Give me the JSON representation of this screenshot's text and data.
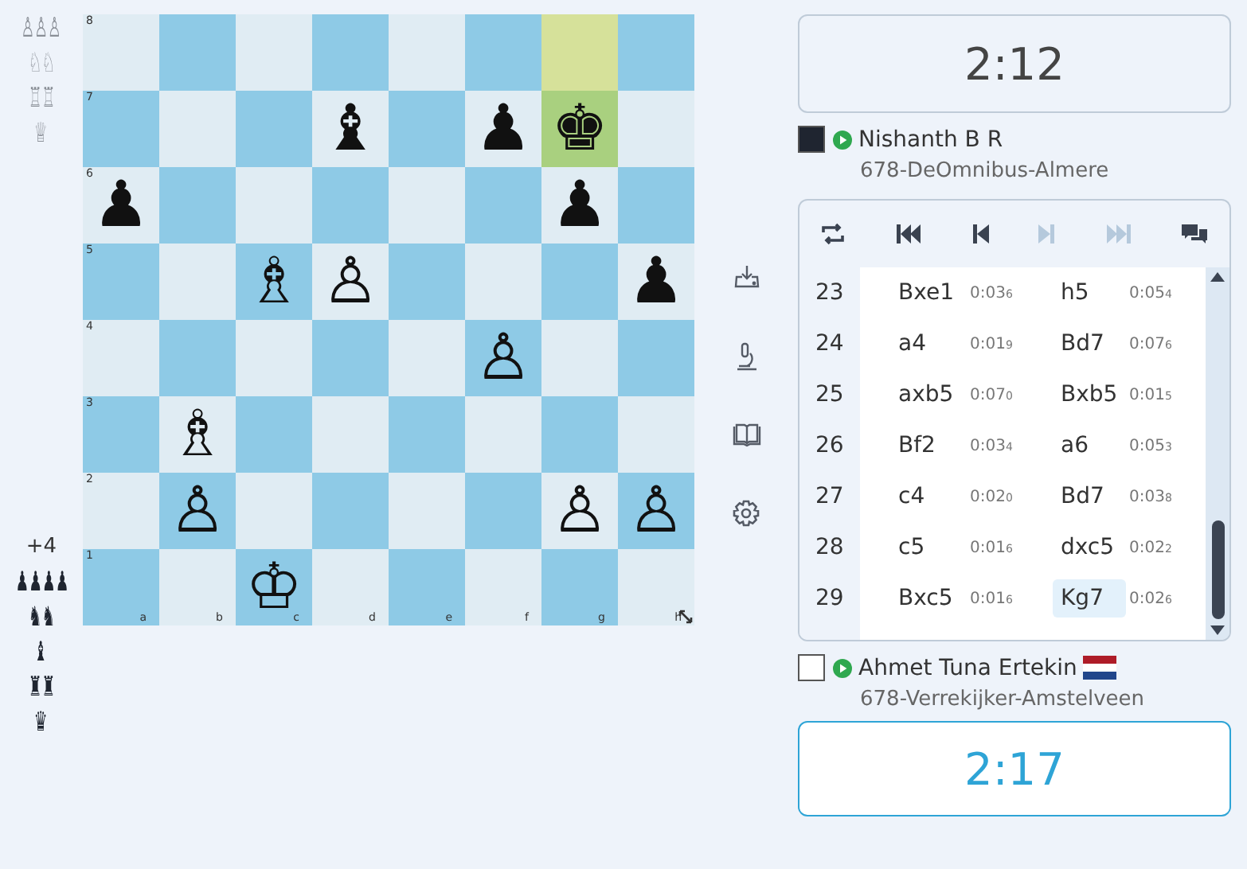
{
  "captured_top": [
    {
      "glyphs": "♙♙♙"
    },
    {
      "glyphs": "♘♘"
    },
    {
      "glyphs": "♖♖"
    },
    {
      "glyphs": "♕"
    }
  ],
  "captured_bottom": {
    "advantage": "+4",
    "groups": [
      {
        "glyphs": "♟♟♟♟"
      },
      {
        "glyphs": "♞♞"
      },
      {
        "glyphs": "♝"
      },
      {
        "glyphs": "♜♜"
      },
      {
        "glyphs": "♛"
      }
    ]
  },
  "board": {
    "files": [
      "a",
      "b",
      "c",
      "d",
      "e",
      "f",
      "g",
      "h"
    ],
    "ranks": [
      {
        "label": "8",
        "squares": [
          {
            "highlighted": false
          },
          {
            "highlighted": false
          },
          {
            "highlighted": false
          },
          {
            "highlighted": false
          },
          {
            "highlighted": false
          },
          {
            "highlighted": false
          },
          {
            "highlighted": true
          },
          {
            "highlighted": false
          }
        ]
      },
      {
        "label": "7",
        "squares": [
          {
            "highlighted": false
          },
          {
            "highlighted": false
          },
          {
            "highlighted": false
          },
          {
            "piece": "♝",
            "highlighted": false
          },
          {
            "highlighted": false
          },
          {
            "piece": "♟",
            "highlighted": false
          },
          {
            "piece": "♚",
            "highlighted": true
          },
          {
            "highlighted": false
          }
        ]
      },
      {
        "label": "6",
        "squares": [
          {
            "piece": "♟",
            "highlighted": false
          },
          {
            "highlighted": false
          },
          {
            "highlighted": false
          },
          {
            "highlighted": false
          },
          {
            "highlighted": false
          },
          {
            "highlighted": false
          },
          {
            "piece": "♟",
            "highlighted": false
          },
          {
            "highlighted": false
          }
        ]
      },
      {
        "label": "5",
        "squares": [
          {
            "highlighted": false
          },
          {
            "highlighted": false
          },
          {
            "piece": "♗",
            "highlighted": false
          },
          {
            "piece": "♙",
            "highlighted": false
          },
          {
            "highlighted": false
          },
          {
            "highlighted": false
          },
          {
            "highlighted": false
          },
          {
            "piece": "♟",
            "highlighted": false
          }
        ]
      },
      {
        "label": "4",
        "squares": [
          {
            "highlighted": false
          },
          {
            "highlighted": false
          },
          {
            "highlighted": false
          },
          {
            "highlighted": false
          },
          {
            "highlighted": false
          },
          {
            "piece": "♙",
            "highlighted": false
          },
          {
            "highlighted": false
          },
          {
            "highlighted": false
          }
        ]
      },
      {
        "label": "3",
        "squares": [
          {
            "highlighted": false
          },
          {
            "piece": "♗",
            "highlighted": false
          },
          {
            "highlighted": false
          },
          {
            "highlighted": false
          },
          {
            "highlighted": false
          },
          {
            "highlighted": false
          },
          {
            "highlighted": false
          },
          {
            "highlighted": false
          }
        ]
      },
      {
        "label": "2",
        "squares": [
          {
            "highlighted": false
          },
          {
            "piece": "♙",
            "highlighted": false
          },
          {
            "highlighted": false
          },
          {
            "highlighted": false
          },
          {
            "highlighted": false
          },
          {
            "highlighted": false
          },
          {
            "piece": "♙",
            "highlighted": false
          },
          {
            "piece": "♙",
            "highlighted": false
          }
        ]
      },
      {
        "label": "1",
        "squares": [
          {
            "highlighted": false
          },
          {
            "highlighted": false
          },
          {
            "piece": "♔",
            "highlighted": false
          },
          {
            "highlighted": false
          },
          {
            "highlighted": false
          },
          {
            "highlighted": false
          },
          {
            "highlighted": false
          },
          {
            "highlighted": false
          }
        ]
      }
    ]
  },
  "top_clock": {
    "time": "2:12",
    "active": false
  },
  "top_player": {
    "kind": "black",
    "online": true,
    "name": "Nishanth B R",
    "club": "678-DeOmnibus-Almere"
  },
  "nav": [
    {
      "kind": "flip",
      "disabled": false
    },
    {
      "kind": "first",
      "disabled": false
    },
    {
      "kind": "prev",
      "disabled": false
    },
    {
      "kind": "next",
      "disabled": true
    },
    {
      "kind": "last",
      "disabled": true
    },
    {
      "kind": "chat",
      "disabled": false
    }
  ],
  "moves": [
    {
      "number": "23",
      "white": {
        "san": "Bxe1",
        "time": "0:03",
        "tenths": "6",
        "selected": false
      },
      "black": {
        "san": "h5",
        "time": "0:05",
        "tenths": "4",
        "selected": false
      }
    },
    {
      "number": "24",
      "white": {
        "san": "a4",
        "time": "0:01",
        "tenths": "9",
        "selected": false
      },
      "black": {
        "san": "Bd7",
        "time": "0:07",
        "tenths": "6",
        "selected": false
      }
    },
    {
      "number": "25",
      "white": {
        "san": "axb5",
        "time": "0:07",
        "tenths": "0",
        "selected": false
      },
      "black": {
        "san": "Bxb5",
        "time": "0:01",
        "tenths": "5",
        "selected": false
      }
    },
    {
      "number": "26",
      "white": {
        "san": "Bf2",
        "time": "0:03",
        "tenths": "4",
        "selected": false
      },
      "black": {
        "san": "a6",
        "time": "0:05",
        "tenths": "3",
        "selected": false
      }
    },
    {
      "number": "27",
      "white": {
        "san": "c4",
        "time": "0:02",
        "tenths": "0",
        "selected": false
      },
      "black": {
        "san": "Bd7",
        "time": "0:03",
        "tenths": "8",
        "selected": false
      }
    },
    {
      "number": "28",
      "white": {
        "san": "c5",
        "time": "0:01",
        "tenths": "6",
        "selected": false
      },
      "black": {
        "san": "dxc5",
        "time": "0:02",
        "tenths": "2",
        "selected": false
      }
    },
    {
      "number": "29",
      "white": {
        "san": "Bxc5",
        "time": "0:01",
        "tenths": "6",
        "selected": false
      },
      "black": {
        "san": "Kg7",
        "time": "0:02",
        "tenths": "6",
        "selected": true
      }
    }
  ],
  "bottom_player": {
    "kind": "white",
    "online": true,
    "name": "Ahmet Tuna Ertekin",
    "flag": {
      "kind": "netherlands"
    },
    "club": "678-Verrekijker-Amstelveen"
  },
  "bottom_clock": {
    "time": "2:17",
    "active": true
  }
}
